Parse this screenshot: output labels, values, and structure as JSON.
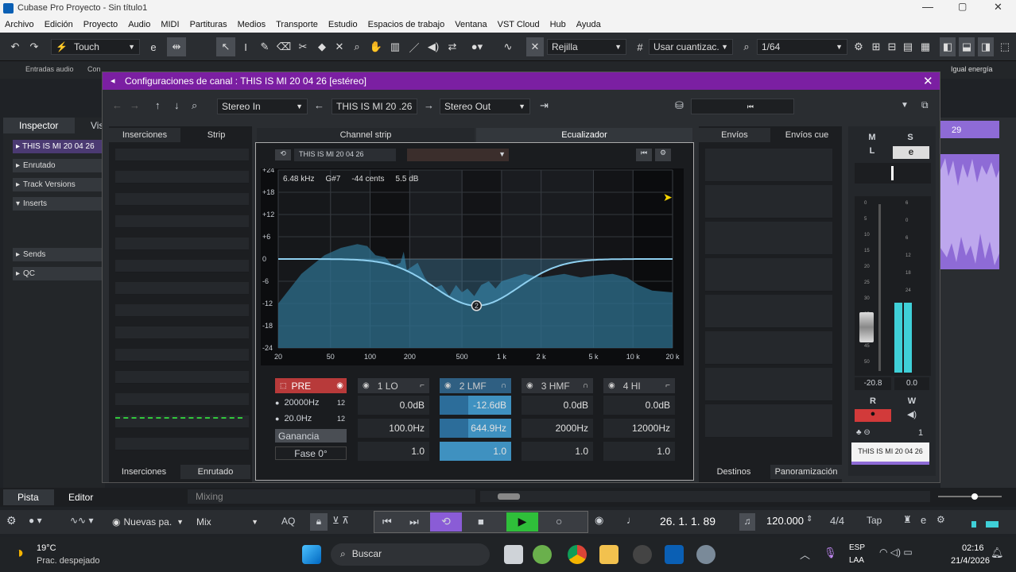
{
  "window": {
    "title": "Cubase Pro Proyecto - Sin título1"
  },
  "menu": [
    "Archivo",
    "Edición",
    "Proyecto",
    "Audio",
    "MIDI",
    "Partituras",
    "Medios",
    "Transporte",
    "Estudio",
    "Espacios de trabajo",
    "Ventana",
    "VST Cloud",
    "Hub",
    "Ayuda"
  ],
  "toolbar": {
    "mode": "Touch",
    "grid": "Rejilla",
    "quantize": "Usar cuantizac.",
    "quant_value": "1/64"
  },
  "subtool": {
    "left": "Entradas audio",
    "left2": "Con",
    "right": "Igual energía"
  },
  "inspector": {
    "tab1": "Inspector",
    "tab2": "Vis",
    "track": "THIS IS MI 20 04 26",
    "items": [
      "Enrutado",
      "Track Versions",
      "Inserts",
      "Sends",
      "QC"
    ]
  },
  "channel": {
    "title": "Configuraciones de canal : THIS IS MI 20 04 26 [estéreo]",
    "input": "Stereo In",
    "name": "THIS IS MI 20 .26",
    "output": "Stereo Out",
    "tabs": {
      "inserts": "Inserciones",
      "strip": "Strip",
      "channel_strip": "Channel strip",
      "eq": "Ecualizador",
      "sends": "Envíos",
      "cue": "Envíos cue"
    },
    "bottom_tabs": {
      "inserts": "Inserciones",
      "routing": "Enrutado",
      "dest": "Destinos",
      "pan": "Panoramización"
    },
    "eq_header": "THIS IS MI 20 04 26",
    "readout": {
      "freq": "6.48 kHz",
      "note": "G#7",
      "cents": "-44 cents",
      "db": "5.5 dB"
    },
    "pre": {
      "label": "PRE",
      "hp": "20000Hz",
      "lp": "20.0Hz",
      "gain": "Ganancia",
      "phase": "Fase 0°"
    },
    "bands": [
      {
        "label": "1 LO",
        "gain": "0.0dB",
        "freq": "100.0Hz",
        "q": "1.0",
        "active": false
      },
      {
        "label": "2 LMF",
        "gain": "-12.6dB",
        "freq": "644.9Hz",
        "q": "1.0",
        "active": true
      },
      {
        "label": "3 HMF",
        "gain": "0.0dB",
        "freq": "2000Hz",
        "q": "1.0",
        "active": false
      },
      {
        "label": "4 HI",
        "gain": "0.0dB",
        "freq": "12000Hz",
        "q": "1.0",
        "active": false
      }
    ],
    "fader": {
      "m": "M",
      "s": "S",
      "l": "L",
      "e": "e",
      "value_l": "-20.8",
      "value_r": "0.0",
      "r": "R",
      "w": "W",
      "num": "1",
      "track": "THIS IS MI 20 04 26",
      "scale": [
        "6",
        "0",
        "6",
        "12",
        "18",
        "24",
        "30",
        "36",
        "48",
        "60"
      ],
      "ticks": [
        "0",
        "5",
        "10",
        "15",
        "20",
        "25",
        "30",
        "35",
        "40",
        "45",
        "50"
      ]
    }
  },
  "eq_chart": {
    "type": "line",
    "x_ticks": [
      "20",
      "50",
      "100",
      "200",
      "500",
      "1 k",
      "2 k",
      "5 k",
      "10 k",
      "20 k"
    ],
    "y_ticks": [
      "+24",
      "+18",
      "+12",
      "+6",
      "0",
      "-6",
      "-12",
      "-18",
      "-24"
    ],
    "ylim": [
      -24,
      24
    ],
    "node_label": "2",
    "node_freq": 644.9,
    "node_gain": -12.6
  },
  "footer": {
    "pista": "Pista",
    "editor": "Editor",
    "mixing": "Mixing"
  },
  "transport": {
    "preset": "Nuevas pa.",
    "mix": "Mix",
    "aq": "AQ",
    "position": "26. 1. 1. 89",
    "tempo": "120.000",
    "sig": "4/4",
    "tap": "Tap"
  },
  "arrange": {
    "marker": "29"
  },
  "taskbar": {
    "temp": "19°C",
    "weather": "Prac. despejado",
    "search": "Buscar",
    "lang1": "ESP",
    "lang2": "LAA",
    "time": "02:16",
    "date": "21/4/2026"
  },
  "colors": {
    "accent": "#7b1fa2",
    "eq_fill": "#2e6f8e",
    "meter": "#3fd0d8",
    "record": "#d23a3a"
  }
}
